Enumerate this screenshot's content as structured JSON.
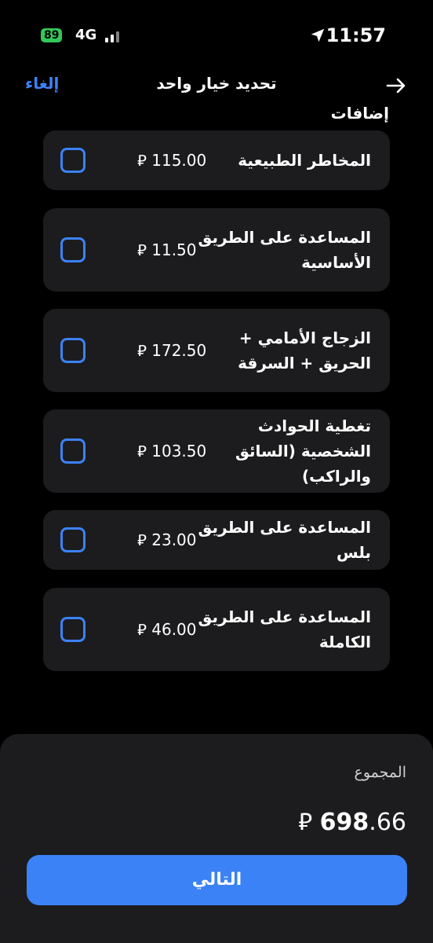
{
  "status_bar": {
    "time": "11:57",
    "battery": "89",
    "network": "4G"
  },
  "nav": {
    "cancel": "إلغاء",
    "title": "تحديد خيار واحد"
  },
  "section_title": "إضافات",
  "currency": "⃁",
  "options": [
    {
      "label": "المخاطر الطبيعية",
      "price": "115.00"
    },
    {
      "label": "المساعدة على الطريق الأساسية",
      "price": "11.50"
    },
    {
      "label": "الزجاج الأمامي + الحريق + السرقة",
      "price": "172.50"
    },
    {
      "label": "تغطية الحوادث الشخصية (السائق والراكب)",
      "price": "103.50"
    },
    {
      "label": "المساعدة على الطريق بلس",
      "price": "23.00"
    },
    {
      "label": "المساعدة على الطريق الكاملة",
      "price": "46.00"
    }
  ],
  "summary": {
    "label": "المجموع",
    "total_int": "698",
    "total_dec": ".66"
  },
  "next_button": "التالي"
}
